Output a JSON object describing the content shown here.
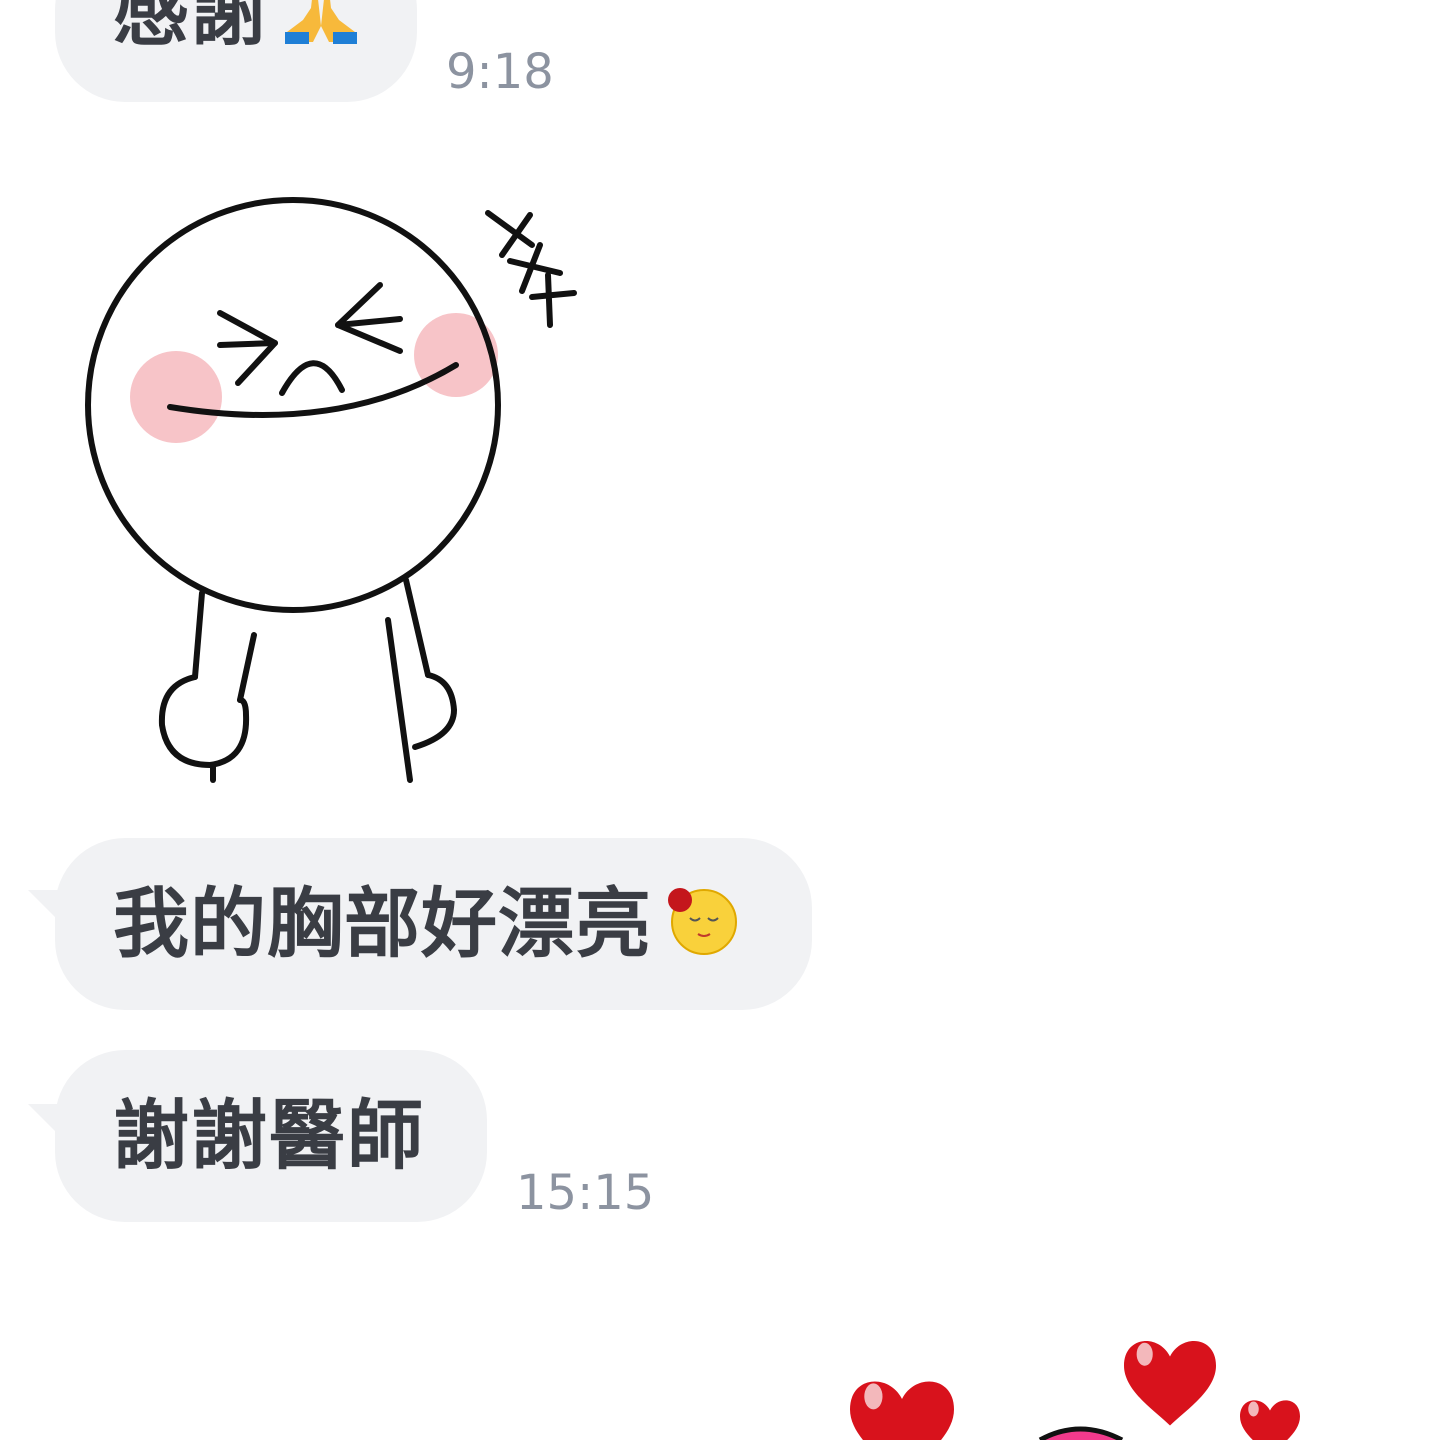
{
  "messages": [
    {
      "type": "text",
      "text": "感謝",
      "emoji": "folded-hands-icon",
      "time": "9:18"
    },
    {
      "type": "sticker",
      "sticker": "laughing-round-face-sticker"
    },
    {
      "type": "text",
      "text": "我的胸部好漂亮",
      "emoji": "blushing-face-icon"
    },
    {
      "type": "text",
      "text": "謝謝醫師",
      "time": "15:15"
    },
    {
      "type": "sticker",
      "sticker": "hearts-sticker"
    }
  ],
  "colors": {
    "bubble": "#f1f2f4",
    "text": "#3a3d44",
    "timestamp": "#8c93a0",
    "cheek": "#f7c4c8",
    "heart": "#d8121c"
  }
}
